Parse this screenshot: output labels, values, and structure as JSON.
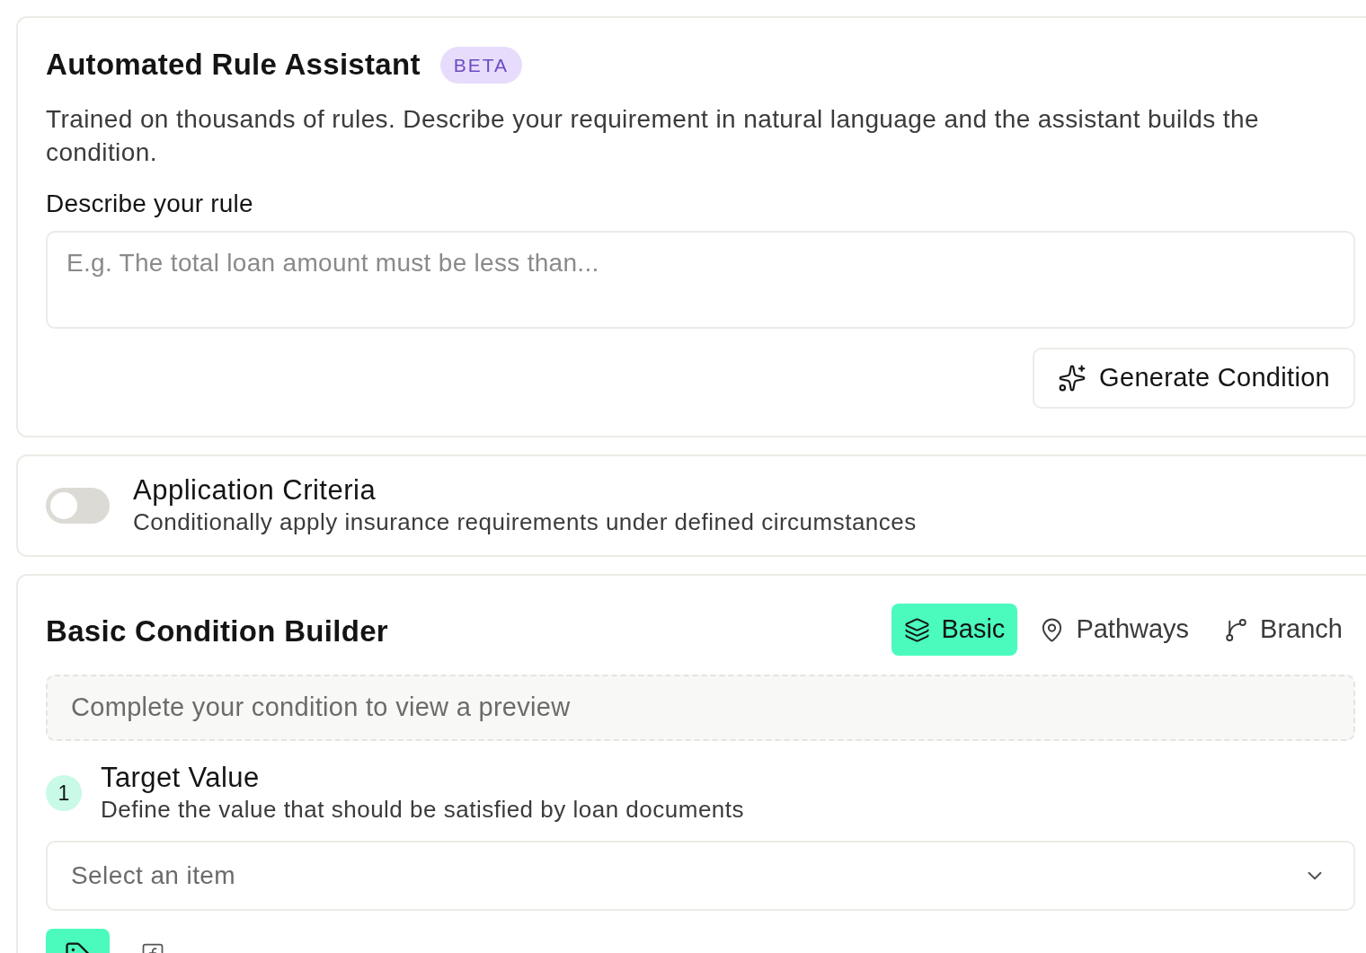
{
  "assistant": {
    "title": "Automated Rule Assistant",
    "badge": "BETA",
    "description": "Trained on thousands of rules. Describe your requirement in natural language and the assistant builds the condition.",
    "field_label": "Describe your rule",
    "field": {
      "placeholder": "E.g. The total loan amount must be less than..."
    },
    "button": "Generate Condition"
  },
  "application_criteria": {
    "on": false,
    "title": "Application Criteria",
    "description": "Conditionally apply insurance requirements under defined circumstances"
  },
  "builder": {
    "title": "Basic Condition Builder",
    "modes": [
      {
        "label": "Basic",
        "selected": true
      },
      {
        "label": "Pathways",
        "selected": false
      },
      {
        "label": "Branch",
        "selected": false
      }
    ],
    "preview_message": "Complete your condition to view a preview",
    "steps": [
      {
        "number": "1",
        "title": "Target Value",
        "description": "Define the value that should be satisfied by loan documents",
        "select": {
          "placeholder": "Select an item"
        },
        "value_sources": [
          {
            "kind": "tag",
            "selected": true
          },
          {
            "kind": "function",
            "selected": false
          }
        ]
      }
    ]
  }
}
